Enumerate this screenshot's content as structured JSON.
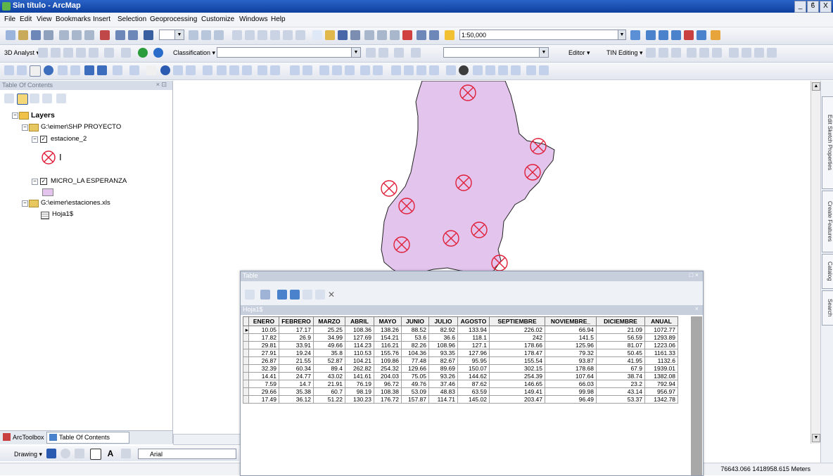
{
  "window": {
    "title": "Sin título - ArcMap",
    "minimize": "_",
    "restore": "ϐ",
    "close": "X"
  },
  "menu": [
    "File",
    "Edit",
    "View",
    "Bookmarks",
    "Insert",
    "Selection",
    "Geoprocessing",
    "Customize",
    "Windows",
    "Help"
  ],
  "toolbar1": {
    "scale": "1:50,000"
  },
  "toolbar2": {
    "analyst": "3D Analyst ▾",
    "classification": "Classification ▾",
    "editor": "Editor ▾",
    "tin_editing": "TIN Editing ▾"
  },
  "toc": {
    "title": "Table Of Contents",
    "layers_label": "Layers",
    "group1": "G:\\eimer\\SHP PROYECTO",
    "layer1": "estacione_2",
    "layer1_legend": "I",
    "layer2": "MICRO_LA ESPERANZA",
    "group2": "G:\\eimer\\estaciones.xls",
    "table1": "Hoja1$"
  },
  "bottom_tabs": {
    "arctoolbox": "ArcToolbox",
    "toc": "Table Of Contents"
  },
  "drawing": {
    "label": "Drawing ▾",
    "font": "Arial"
  },
  "status": {
    "coords": "76643.066  1418958.615 Meters"
  },
  "side_tabs": [
    "Edit Sketch Properties",
    "Create Features",
    "Catalog",
    "Search"
  ],
  "table": {
    "window_title": "Table",
    "tab_title": "Hoja1$",
    "columns": [
      "ENERO",
      "FEBRERO",
      "MARZO",
      "ABRIL",
      "MAYO",
      "JUNIO",
      "JULIO",
      "AGOSTO",
      "SEPTIEMBRE",
      "NOVIEMBRE_",
      "DICIEMBRE",
      "ANUAL"
    ],
    "rows": [
      [
        "10.05",
        "17.17",
        "25.25",
        "108.36",
        "138.26",
        "88.52",
        "82.92",
        "133.94",
        "226.02",
        "66.94",
        "21.09",
        "1072.77"
      ],
      [
        "17.82",
        "26.9",
        "34.99",
        "127.69",
        "154.21",
        "53.6",
        "36.6",
        "118.1",
        "242",
        "141.5",
        "56.59",
        "1293.89"
      ],
      [
        "29.81",
        "33.91",
        "49.66",
        "114.23",
        "116.21",
        "82.26",
        "108.96",
        "127.1",
        "178.66",
        "125.96",
        "81.07",
        "1223.06"
      ],
      [
        "27.91",
        "19.24",
        "35.8",
        "110.53",
        "155.76",
        "104.36",
        "93.35",
        "127.96",
        "178.47",
        "79.32",
        "50.45",
        "1161.33"
      ],
      [
        "26.87",
        "21.55",
        "52.87",
        "104.21",
        "109.86",
        "77.48",
        "82.67",
        "95.95",
        "155.54",
        "93.87",
        "41.95",
        "1132.6"
      ],
      [
        "32.39",
        "60.34",
        "89.4",
        "262.82",
        "254.32",
        "129.66",
        "89.69",
        "150.07",
        "302.15",
        "178.68",
        "67.9",
        "1939.01"
      ],
      [
        "14.41",
        "24.77",
        "43.02",
        "141.61",
        "204.03",
        "75.05",
        "93.26",
        "144.62",
        "254.39",
        "107.64",
        "38.74",
        "1382.08"
      ],
      [
        "7.59",
        "14.7",
        "21.91",
        "76.19",
        "96.72",
        "49.76",
        "37.46",
        "87.62",
        "146.65",
        "66.03",
        "23.2",
        "792.94"
      ],
      [
        "29.66",
        "35.38",
        "60.7",
        "98.19",
        "108.38",
        "53.09",
        "48.83",
        "63.59",
        "149.41",
        "99.98",
        "43.14",
        "956.97"
      ],
      [
        "17.49",
        "36.12",
        "51.22",
        "130.23",
        "176.72",
        "157.87",
        "114.71",
        "145.02",
        "203.47",
        "96.49",
        "53.37",
        "1342.78"
      ]
    ]
  },
  "colors": {
    "polygon_fill": "#e3c4ec",
    "polygon_stroke": "#222222",
    "station": "#e0203a",
    "titlebar": "#1a4fb5"
  }
}
